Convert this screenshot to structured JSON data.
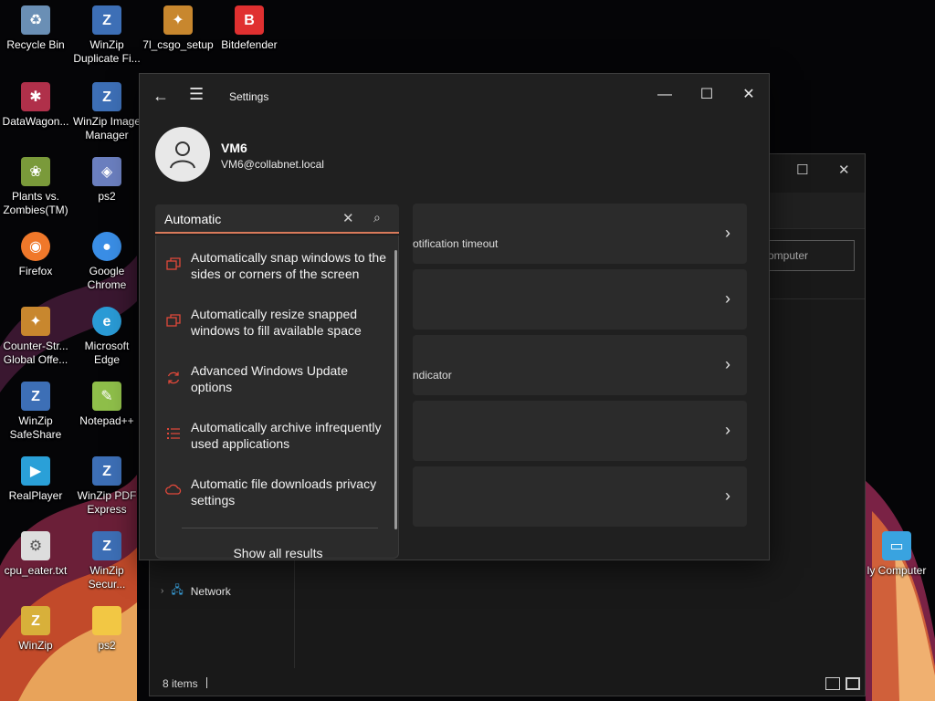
{
  "desktop": {
    "icons": [
      {
        "label": "Recycle Bin",
        "icon": "recycle-bin-icon",
        "color": "#6a8fb5"
      },
      {
        "label": "WinZip Duplicate Fi...",
        "icon": "winzip-icon",
        "color": "#3d6fb6"
      },
      {
        "label": "7l_csgo_setup",
        "icon": "csgo-icon",
        "color": "#c8872e"
      },
      {
        "label": "Bitdefender",
        "icon": "bitdefender-icon",
        "color": "#e03030"
      },
      {
        "label": "DataWagon...",
        "icon": "datawagon-icon",
        "color": "#b0304a"
      },
      {
        "label": "WinZip Image Manager",
        "icon": "winzip-image-icon",
        "color": "#3d6fb6"
      },
      {
        "label": "Plants vs. Zombies(TM)",
        "icon": "plants-icon",
        "color": "#7a9a3a"
      },
      {
        "label": "ps2",
        "icon": "ps2-icon",
        "color": "#6b7fbf"
      },
      {
        "label": "Firefox",
        "icon": "firefox-icon",
        "color": "#f0782a"
      },
      {
        "label": "Google Chrome",
        "icon": "chrome-icon",
        "color": "#3a8ee6"
      },
      {
        "label": "Counter-Str... Global Offe...",
        "icon": "csgo-icon",
        "color": "#c8872e"
      },
      {
        "label": "Microsoft Edge",
        "icon": "edge-icon",
        "color": "#2a9bd6"
      },
      {
        "label": "WinZip SafeShare",
        "icon": "winzip-safeshare-icon",
        "color": "#3d6fb6"
      },
      {
        "label": "Notepad++",
        "icon": "notepadpp-icon",
        "color": "#8fbf4a"
      },
      {
        "label": "RealPlayer",
        "icon": "realplayer-icon",
        "color": "#2aa0d8"
      },
      {
        "label": "WinZip PDF Express",
        "icon": "winzip-pdf-icon",
        "color": "#3d6fb6"
      },
      {
        "label": "cpu_eater.txt",
        "icon": "text-file-icon",
        "color": "#dddddd"
      },
      {
        "label": "WinZip Secur...",
        "icon": "winzip-secure-icon",
        "color": "#3d6fb6"
      },
      {
        "label": "WinZip",
        "icon": "winzip-icon",
        "color": "#d8b03a"
      },
      {
        "label": "ps2",
        "icon": "folder-icon",
        "color": "#f2c744"
      },
      {
        "label": "ly Computer",
        "icon": "computer-icon",
        "color": "#39a3e0"
      }
    ]
  },
  "explorer": {
    "search_placeholder": "omputer",
    "nav_network": "Network",
    "status_items": "8 items"
  },
  "settings": {
    "title": "Settings",
    "account": {
      "name": "VM6",
      "email": "VM6@collabnet.local"
    },
    "search": {
      "value": "Automatic"
    },
    "results": [
      {
        "label": "Automatically snap windows to the sides or corners of the screen",
        "icon": "snap-window-icon"
      },
      {
        "label": "Automatically resize snapped windows to fill available space",
        "icon": "snap-window-icon"
      },
      {
        "label": "Advanced Windows Update options",
        "icon": "update-sync-icon"
      },
      {
        "label": "Automatically archive infrequently used applications",
        "icon": "app-list-icon"
      },
      {
        "label": "Automatic file downloads privacy settings",
        "icon": "cloud-icon"
      }
    ],
    "show_all": "Show all results",
    "cards": [
      {
        "text": "otification timeout"
      },
      {
        "text": ""
      },
      {
        "text": "ndicator"
      },
      {
        "text": ""
      },
      {
        "text": ""
      }
    ],
    "accent_color": "#d97a5a",
    "result_icon_color": "#e0483a"
  }
}
